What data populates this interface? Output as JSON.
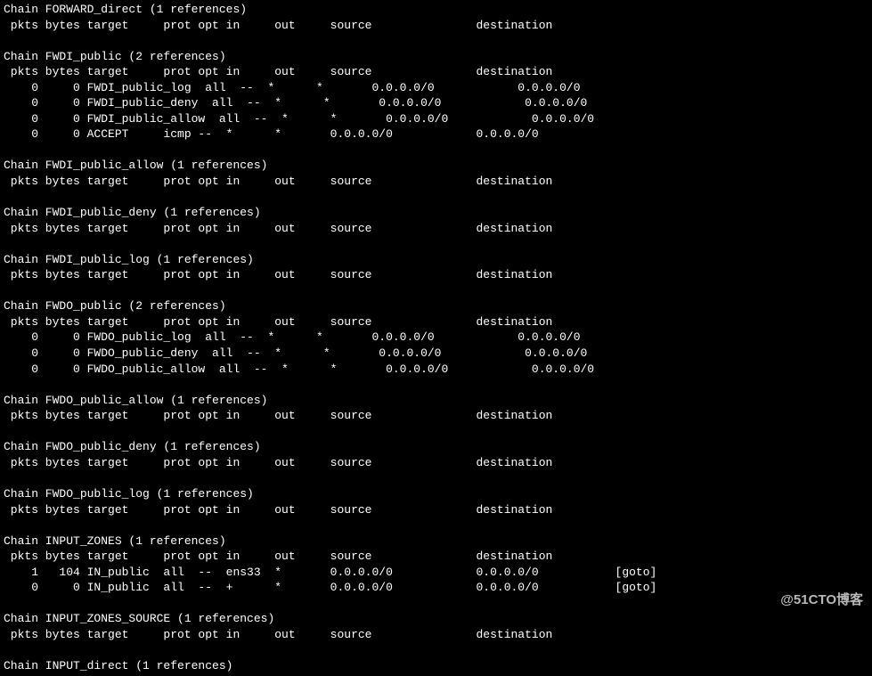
{
  "watermark": "@51CTO博客",
  "chains": [
    {
      "title": "Chain FORWARD_direct (1 references)",
      "header": " pkts bytes target     prot opt in     out     source               destination",
      "rows": []
    },
    {
      "title": "Chain FWDI_public (2 references)",
      "header": " pkts bytes target     prot opt in     out     source               destination",
      "rows": [
        "    0     0 FWDI_public_log  all  --  *      *       0.0.0.0/0            0.0.0.0/0",
        "    0     0 FWDI_public_deny  all  --  *      *       0.0.0.0/0            0.0.0.0/0",
        "    0     0 FWDI_public_allow  all  --  *      *       0.0.0.0/0            0.0.0.0/0",
        "    0     0 ACCEPT     icmp --  *      *       0.0.0.0/0            0.0.0.0/0"
      ]
    },
    {
      "title": "Chain FWDI_public_allow (1 references)",
      "header": " pkts bytes target     prot opt in     out     source               destination",
      "rows": []
    },
    {
      "title": "Chain FWDI_public_deny (1 references)",
      "header": " pkts bytes target     prot opt in     out     source               destination",
      "rows": []
    },
    {
      "title": "Chain FWDI_public_log (1 references)",
      "header": " pkts bytes target     prot opt in     out     source               destination",
      "rows": []
    },
    {
      "title": "Chain FWDO_public (2 references)",
      "header": " pkts bytes target     prot opt in     out     source               destination",
      "rows": [
        "    0     0 FWDO_public_log  all  --  *      *       0.0.0.0/0            0.0.0.0/0",
        "    0     0 FWDO_public_deny  all  --  *      *       0.0.0.0/0            0.0.0.0/0",
        "    0     0 FWDO_public_allow  all  --  *      *       0.0.0.0/0            0.0.0.0/0"
      ]
    },
    {
      "title": "Chain FWDO_public_allow (1 references)",
      "header": " pkts bytes target     prot opt in     out     source               destination",
      "rows": []
    },
    {
      "title": "Chain FWDO_public_deny (1 references)",
      "header": " pkts bytes target     prot opt in     out     source               destination",
      "rows": []
    },
    {
      "title": "Chain FWDO_public_log (1 references)",
      "header": " pkts bytes target     prot opt in     out     source               destination",
      "rows": []
    },
    {
      "title": "Chain INPUT_ZONES (1 references)",
      "header": " pkts bytes target     prot opt in     out     source               destination",
      "rows": [
        "    1   104 IN_public  all  --  ens33  *       0.0.0.0/0            0.0.0.0/0           [goto]",
        "    0     0 IN_public  all  --  +      *       0.0.0.0/0            0.0.0.0/0           [goto]"
      ]
    },
    {
      "title": "Chain INPUT_ZONES_SOURCE (1 references)",
      "header": " pkts bytes target     prot opt in     out     source               destination",
      "rows": []
    },
    {
      "title": "Chain INPUT_direct (1 references)",
      "header": null,
      "rows": []
    }
  ]
}
